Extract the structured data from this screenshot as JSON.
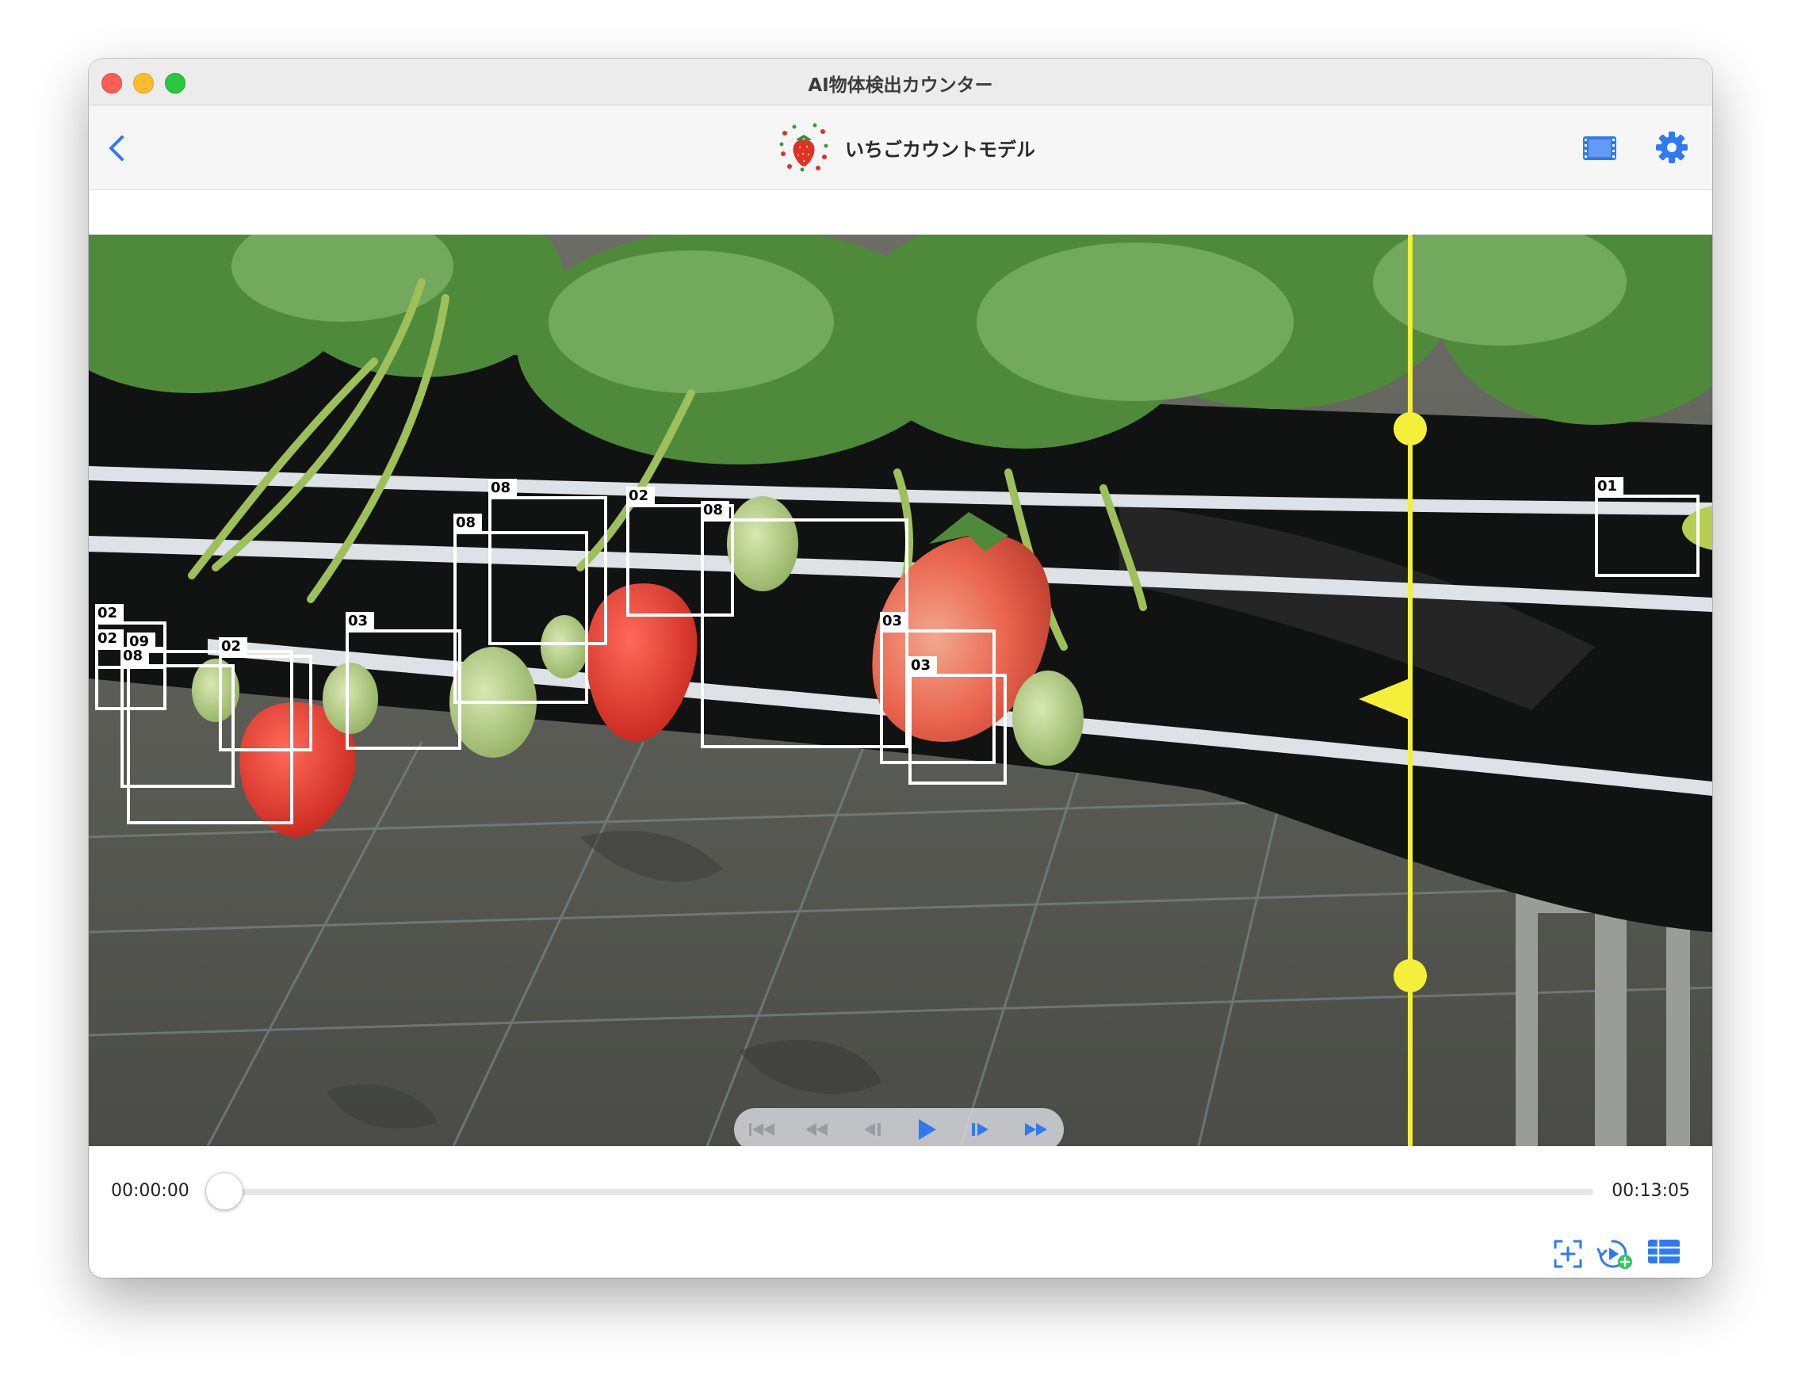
{
  "window": {
    "title": "AI物体検出カウンター"
  },
  "navbar": {
    "model_name": "いちごカウントモデル"
  },
  "detections": [
    {
      "label": "02"
    },
    {
      "label": "02"
    },
    {
      "label": "09"
    },
    {
      "label": "08"
    },
    {
      "label": "02"
    },
    {
      "label": "03"
    },
    {
      "label": "08"
    },
    {
      "label": "08"
    },
    {
      "label": "02"
    },
    {
      "label": "08"
    },
    {
      "label": "03"
    },
    {
      "label": "03"
    },
    {
      "label": "01"
    }
  ],
  "player": {
    "current_time": "00:00:00",
    "total_time": "00:13:05",
    "progress": 0.0
  },
  "colors": {
    "accent": "#2f7af0",
    "count_line": "#f4f03a",
    "box": "#ffffff"
  },
  "icons": {
    "back": "chevron-left-icon",
    "film": "film-strip-icon",
    "settings": "gear-icon",
    "skip_back": "skip-back-icon",
    "rewind": "rewind-icon",
    "step_back": "step-back-icon",
    "play": "play-icon",
    "step_forward": "step-forward-icon",
    "fast_forward": "fast-forward-icon",
    "add_area": "add-area-icon",
    "add_video": "add-video-icon",
    "grid": "table-grid-icon"
  }
}
